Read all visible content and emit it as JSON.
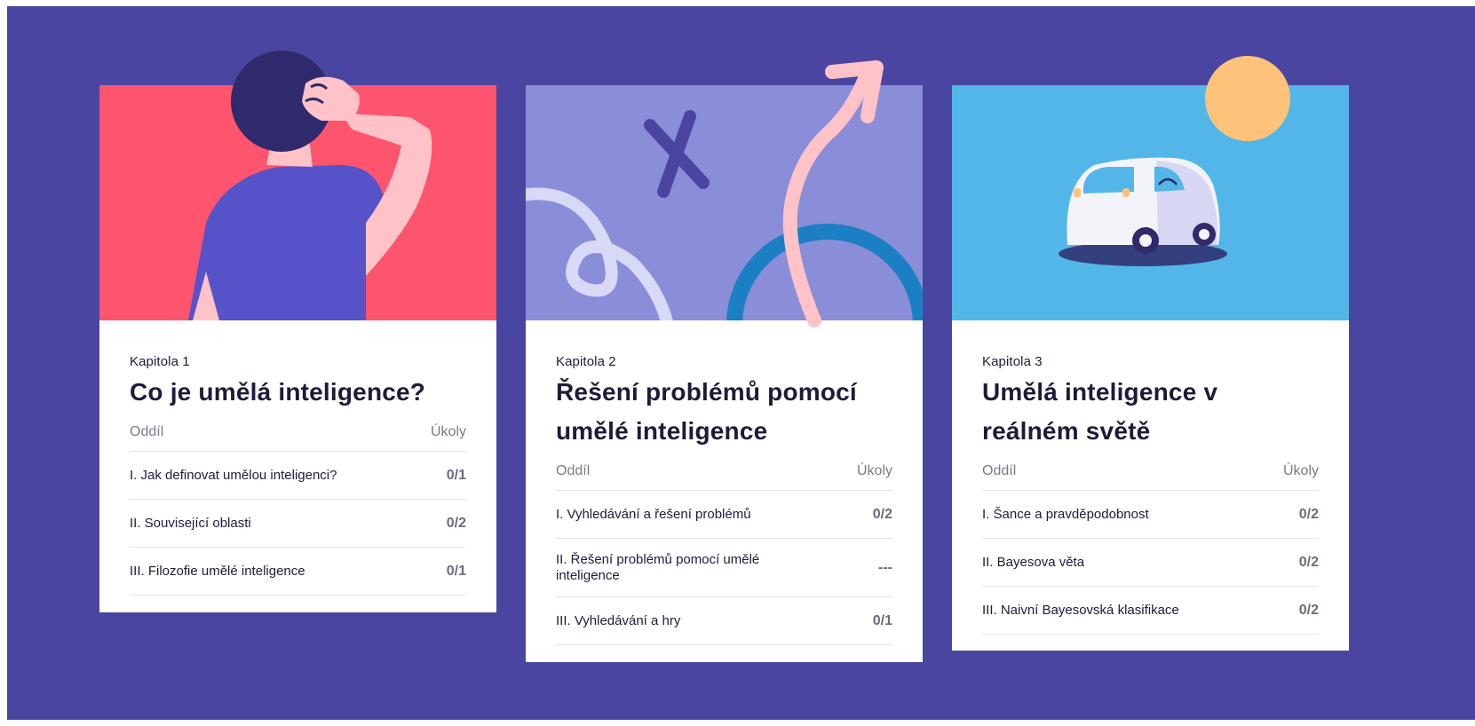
{
  "colors": {
    "background": "#4A45A1",
    "card1_hero": "#FF546E",
    "card2_hero": "#8A8DD8",
    "card3_hero": "#52B7E8",
    "text_dark": "#1E1B3A",
    "text_muted": "#7A7A8C"
  },
  "chapters": [
    {
      "kicker": "Kapitola 1",
      "title": "Co je umělá inteligence?",
      "section_header": "Oddíl",
      "tasks_header": "Úkoly",
      "sections": [
        {
          "label": "I. Jak definovat umělou inteligenci?",
          "score": "0/1"
        },
        {
          "label": "II. Související oblasti",
          "score": "0/2"
        },
        {
          "label": "III. Filozofie umělé inteligence",
          "score": "0/1"
        }
      ]
    },
    {
      "kicker": "Kapitola 2",
      "title": "Řešení problémů pomocí umělé inteligence",
      "section_header": "Oddíl",
      "tasks_header": "Úkoly",
      "sections": [
        {
          "label": "I. Vyhledávání a řešení problémů",
          "score": "0/2"
        },
        {
          "label": "II. Řešení problémů pomocí umělé inteligence",
          "score": "---"
        },
        {
          "label": "III. Vyhledávání a hry",
          "score": "0/1"
        }
      ]
    },
    {
      "kicker": "Kapitola 3",
      "title": "Umělá inteligence v reálném světě",
      "section_header": "Oddíl",
      "tasks_header": "Úkoly",
      "sections": [
        {
          "label": "I. Šance a pravděpodobnost",
          "score": "0/2"
        },
        {
          "label": "II. Bayesova věta",
          "score": "0/2"
        },
        {
          "label": "III. Naivní Bayesovská klasifikace",
          "score": "0/2"
        }
      ]
    }
  ]
}
